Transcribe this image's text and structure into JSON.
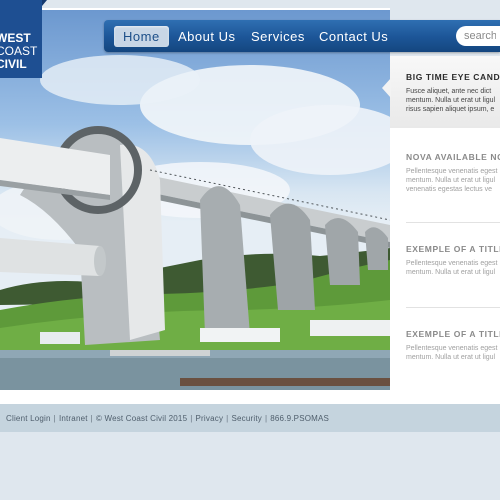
{
  "logo": {
    "line1": "WEST",
    "line2": "COAST",
    "line3": "CIVIL"
  },
  "nav": {
    "items": [
      "Home",
      "About Us",
      "Services",
      "Contact Us"
    ],
    "active": "Home",
    "search_placeholder": "search ..."
  },
  "sidebar": {
    "featured": {
      "title": "BIG TIME EYE CANDY",
      "line1": "Fusce aliquet, ante nec dict",
      "line2": "mentum. Nulla ut erat ut ligul",
      "line3": "risus sapien aliquet ipsum, e"
    },
    "items": [
      {
        "title": "NOVA AVAILABLE NOW",
        "line1": "Pellentesque venenatis egest",
        "line2": "mentum. Nulla ut erat ut ligul",
        "line3": "venenatis egestas lectus ve"
      },
      {
        "title": "EXEMPLE OF A TITLE",
        "line1": "Pellentesque venenatis egest",
        "line2": "mentum. Nulla ut erat ut ligul"
      },
      {
        "title": "EXEMPLE OF A TITLE",
        "line1": "Pellentesque venenatis egest",
        "line2": "mentum. Nulla ut erat ut ligul"
      }
    ]
  },
  "footer": {
    "client_login": "Client Login",
    "intranet": "Intranet",
    "copyright": "© West Coast Civil 2015",
    "privacy": "Privacy",
    "security": "Security",
    "phone": "866.9.PSOMAS"
  },
  "colors": {
    "brand": "#1e4f92",
    "nav": "#1c5597",
    "footer": "#c5d4de"
  }
}
